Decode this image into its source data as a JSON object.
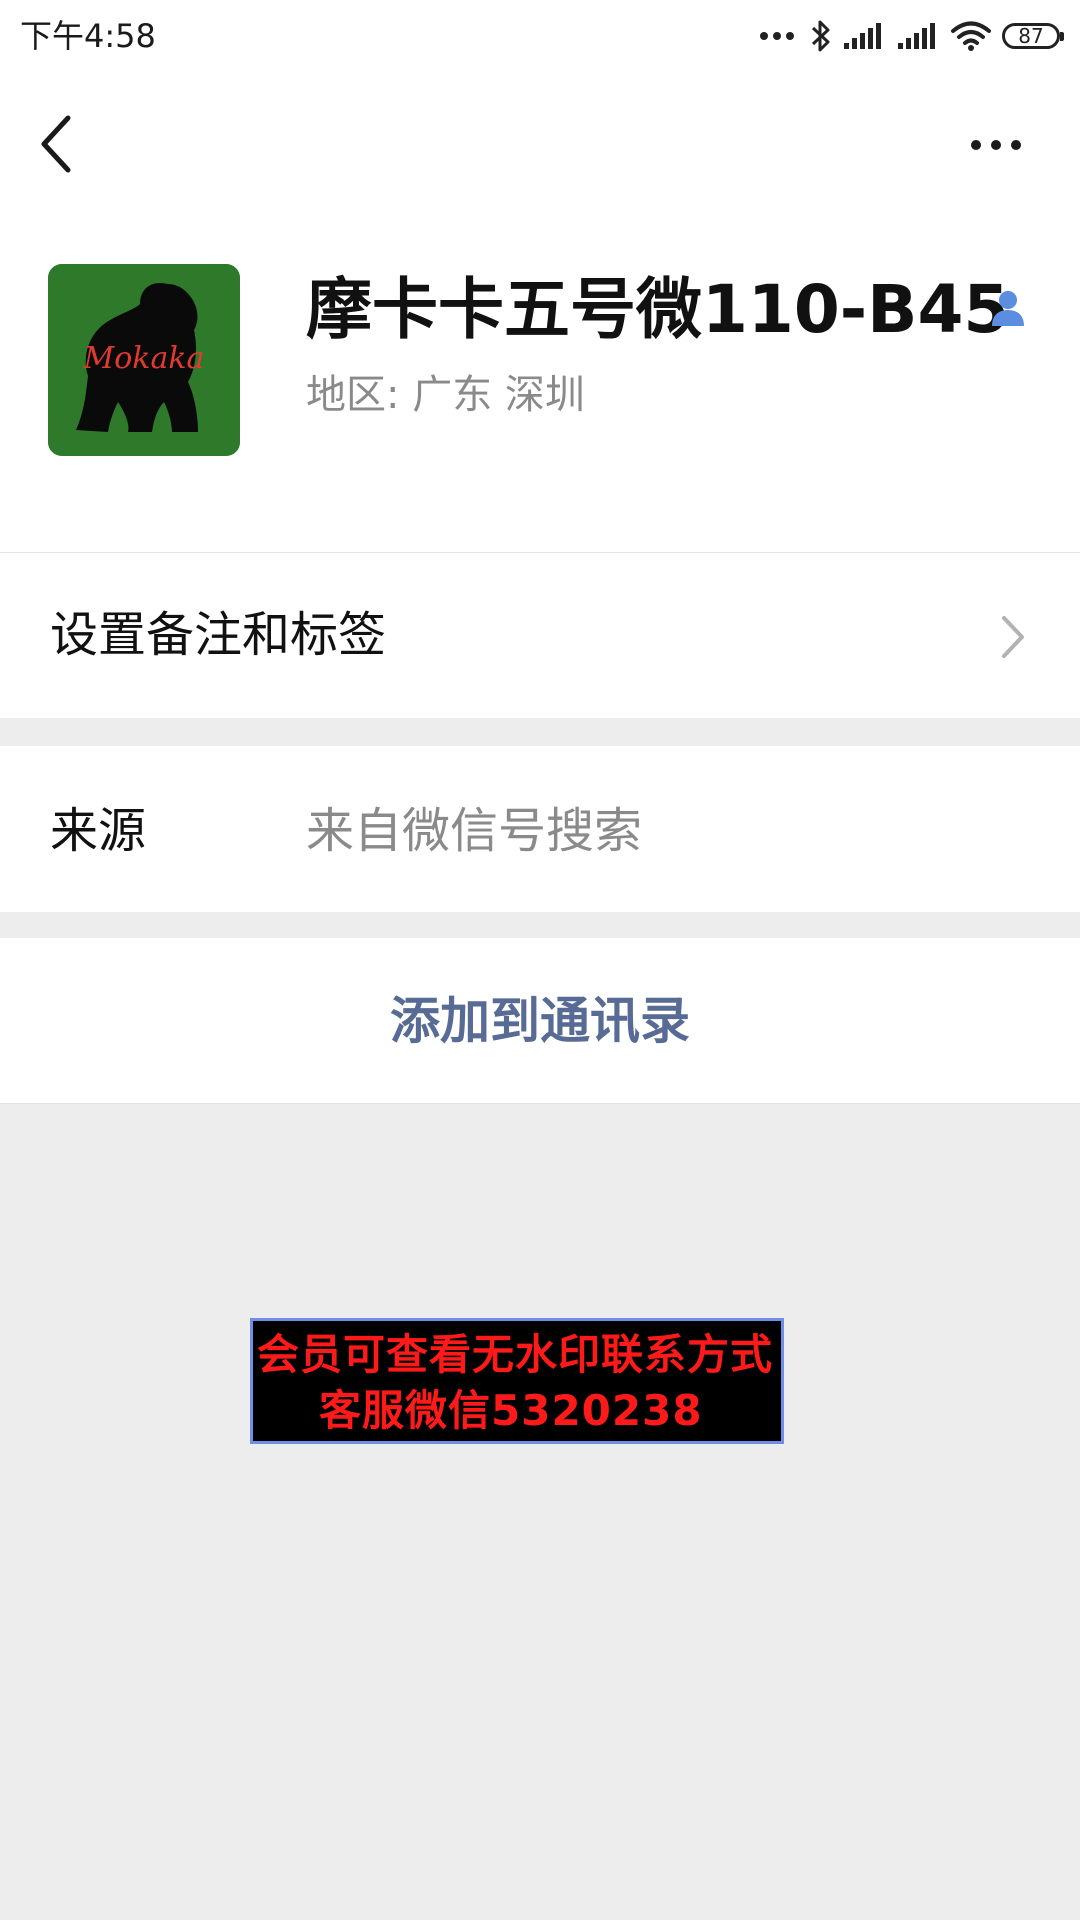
{
  "status_bar": {
    "time": "下午4:58",
    "battery": "87",
    "icons": [
      "more-dots-icon",
      "bluetooth-icon",
      "signal-icon",
      "signal-icon",
      "wifi-icon",
      "battery-icon"
    ]
  },
  "nav": {
    "back_icon": "chevron-left-icon",
    "more_icon": "more-horizontal-icon"
  },
  "profile": {
    "name": "摩卡卡五号微110-B45",
    "region": "地区:  广东  深圳",
    "avatar_text": "Mokaka",
    "avatar_bg": "#2e7a2a",
    "verified_icon": "person-icon"
  },
  "rows": {
    "remarks_label": "设置备注和标签",
    "source_label": "来源",
    "source_value": "来自微信号搜索"
  },
  "actions": {
    "add_to_contacts": "添加到通讯录",
    "accent": "#576b95"
  },
  "watermark": {
    "line1": "会员可查看无水印联系方式",
    "line2": "客服微信5320238"
  }
}
